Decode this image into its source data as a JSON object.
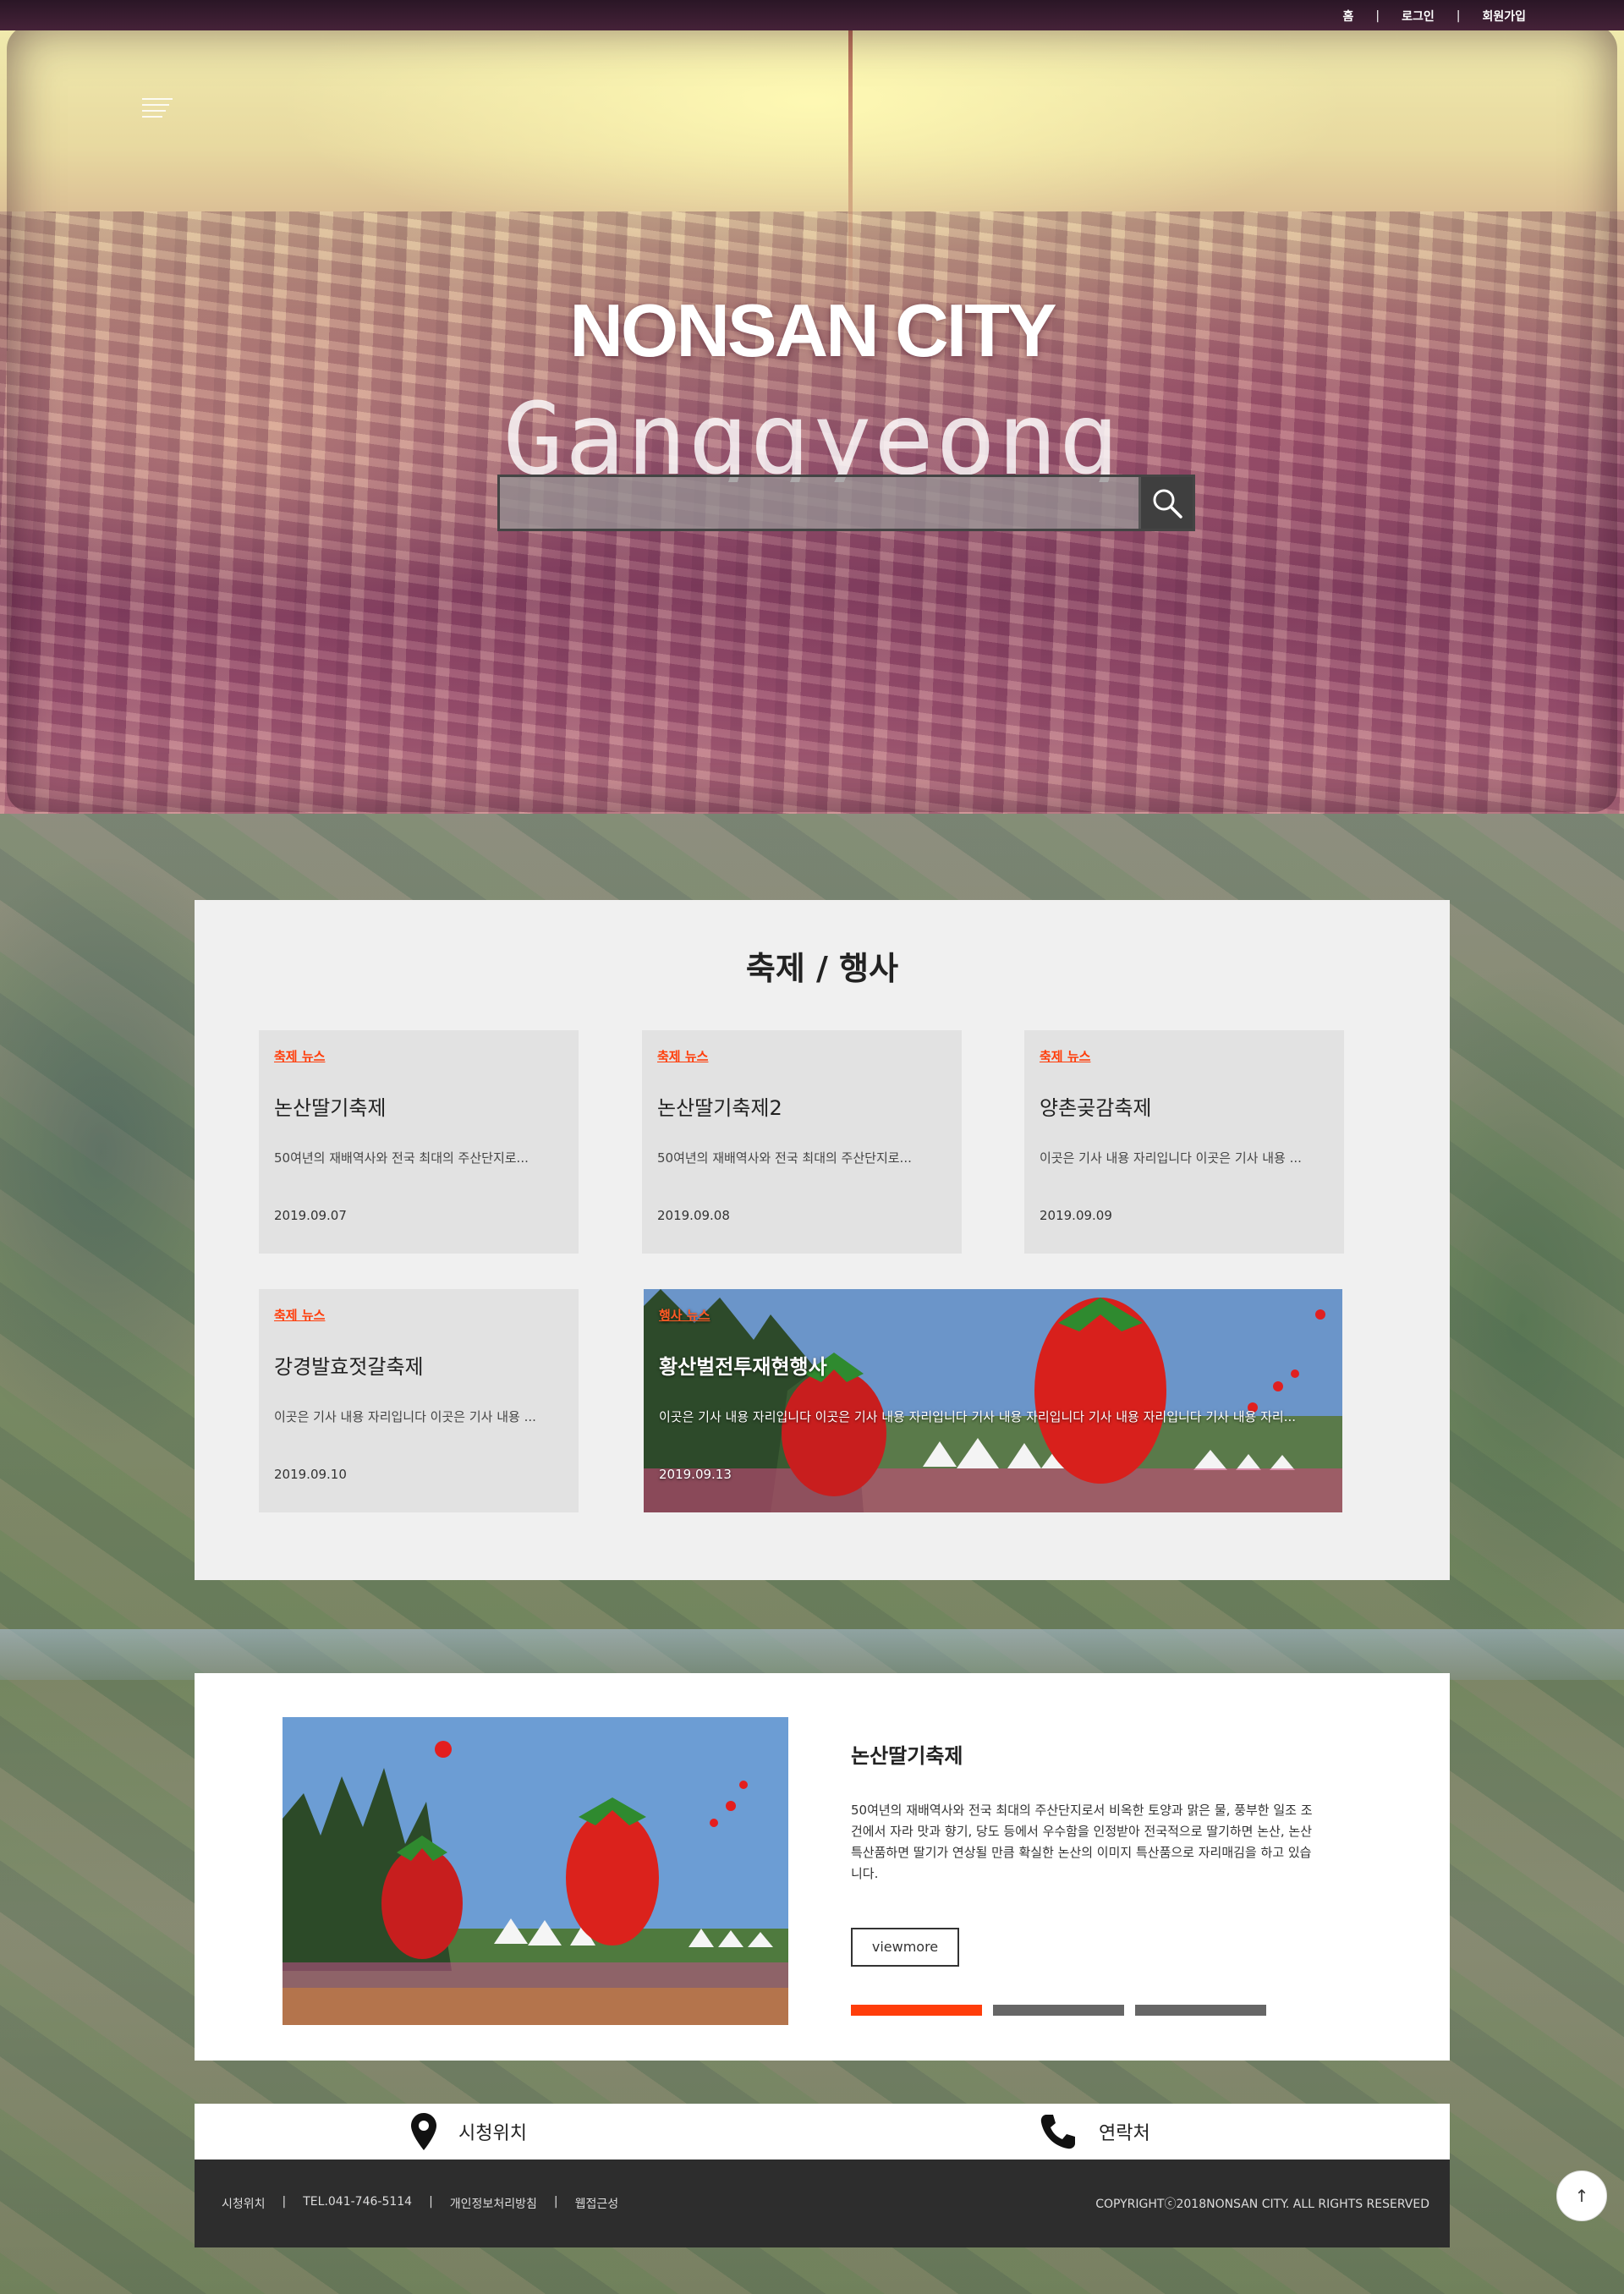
{
  "topnav": {
    "home": "홈",
    "login": "로그인",
    "signup": "회원가입",
    "sep": "|"
  },
  "hero": {
    "title": "NONSAN CITY",
    "subtitle": "Ganggyeong",
    "search_placeholder": ""
  },
  "festival": {
    "title": "축제 / 행사",
    "cards": [
      {
        "category": "축제 뉴스",
        "title": "논산딸기축제",
        "desc": "50여년의 재배역사와 전국 최대의 주산단지로...",
        "date": "2019.09.07"
      },
      {
        "category": "축제 뉴스",
        "title": "논산딸기축제2",
        "desc": "50여년의 재배역사와 전국 최대의 주산단지로...",
        "date": "2019.09.08"
      },
      {
        "category": "축제 뉴스",
        "title": "양촌곶감축제",
        "desc": "이곳은 기사 내용 자리입니다 이곳은 기사 내용 ...",
        "date": "2019.09.09"
      },
      {
        "category": "축제 뉴스",
        "title": "강경발효젓갈축제",
        "desc": "이곳은 기사 내용 자리입니다 이곳은 기사 내용 ...",
        "date": "2019.09.10"
      },
      {
        "category": "행사 뉴스",
        "title": "황산벌전투재현행사",
        "desc": "이곳은 기사 내용 자리입니다 이곳은 기사 내용 자리입니다 기사 내용 자리입니다 기사 내용 자리입니다 기사 내용 자리...",
        "date": "2019.09.13"
      }
    ]
  },
  "featured": {
    "title": "논산딸기축제",
    "desc": "50여년의 재배역사와 전국 최대의 주산단지로서 비옥한 토양과 맑은 물, 풍부한 일조 조건에서 자라 맛과 향기, 당도 등에서 우수함을 인정받아 전국적으로 딸기하면 논산, 논산 특산품하면 딸기가 연상될 만큼 확실한 논산의 이미지 특산품으로 자리매김을 하고 있습니다.",
    "button": "viewmore",
    "active_slide": 1,
    "slide_count": 3
  },
  "info": {
    "location": "시청위치",
    "contact": "연락처"
  },
  "footer": {
    "links": [
      "시청위치",
      "TEL.041-746-5114",
      "개인정보처리방침",
      "웹접근성"
    ],
    "sep": "|",
    "copyright": "COPYRIGHTⓒ2018NONSAN CITY. ALL RIGHTS RESERVED"
  },
  "top_button": "↑",
  "colors": {
    "accent": "#ff3d0a",
    "footer_bg": "#2d2d2d",
    "card_bg": "#e2e2e2"
  },
  "icons": [
    "menu-icon",
    "search-icon",
    "location-pin-icon",
    "phone-icon",
    "arrow-up-icon"
  ]
}
